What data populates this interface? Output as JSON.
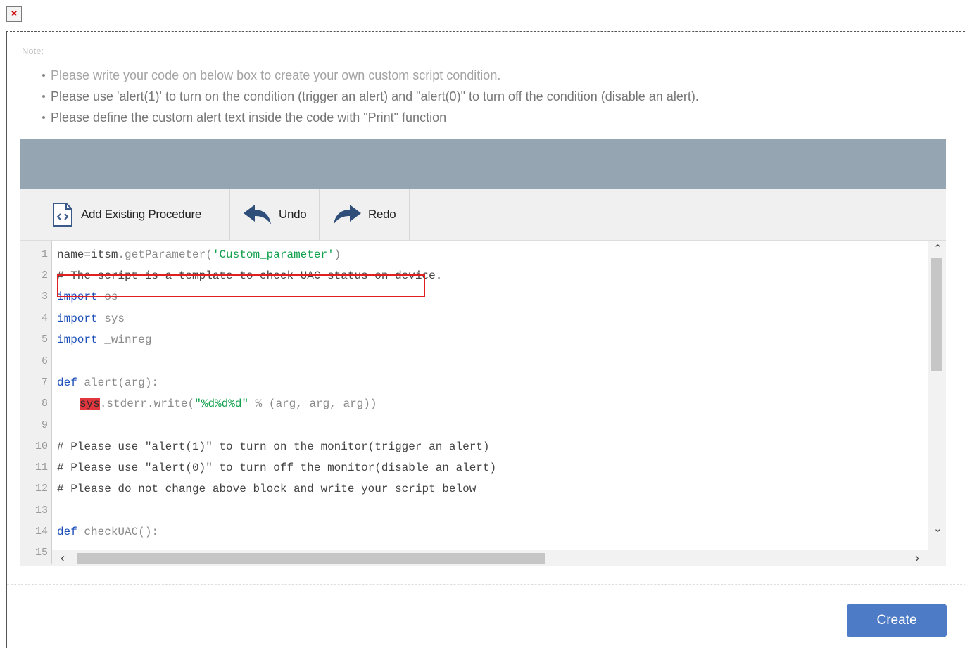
{
  "close_icon_glyph": "×",
  "note": {
    "label": "Note:",
    "items": [
      "Please write your code on below box to create your own custom script condition.",
      "Please use 'alert(1)' to turn on the condition (trigger an alert) and \"alert(0)\" to turn off the condition (disable an alert).",
      "Please define the custom alert text inside the code with \"Print\" function"
    ]
  },
  "toolbar": {
    "add_existing_label": "Add Existing Procedure",
    "undo_label": "Undo",
    "redo_label": "Redo"
  },
  "editor": {
    "line_numbers": [
      "1",
      "2",
      "3",
      "4",
      "5",
      "6",
      "7",
      "8",
      "9",
      "10",
      "11",
      "12",
      "13",
      "14",
      "15"
    ],
    "code": {
      "l1_name": "name",
      "l1_eq": "=",
      "l1_obj": "itsm",
      "l1_call": ".getParameter(",
      "l1_str": "'Custom_parameter'",
      "l1_close": ")",
      "l2": "# The script is a template to check UAC status on device.",
      "l3_kw": "import",
      "l3_rest": " os",
      "l4_kw": "import",
      "l4_rest": " sys",
      "l5_kw": "import",
      "l5_rest": " _winreg",
      "l7_kw": "def",
      "l7_name": " alert",
      "l7_args": "(arg):",
      "l8_err": "sys",
      "l8_call": ".stderr.write(",
      "l8_str": "\"%d%d%d\"",
      "l8_rest": " % (arg, arg, arg))",
      "l10": "# Please use \"alert(1)\" to turn on the monitor(trigger an alert)",
      "l11": "# Please use \"alert(0)\" to turn off the monitor(disable an alert)",
      "l12": "# Please do not change above block and write your script below",
      "l14_kw": "def",
      "l14_name": " checkUAC",
      "l14_args": "():"
    }
  },
  "scroll_arrows": {
    "up": "⌃",
    "down": "⌄",
    "left": "‹",
    "right": "›"
  },
  "create_label": "Create",
  "colors": {
    "header_bar": "#95a5b2",
    "create_button": "#4e7bc6",
    "keyword": "#1c4fb8",
    "string": "#11a04c",
    "highlight_border": "#e02020",
    "error_bg": "#e2363f"
  }
}
